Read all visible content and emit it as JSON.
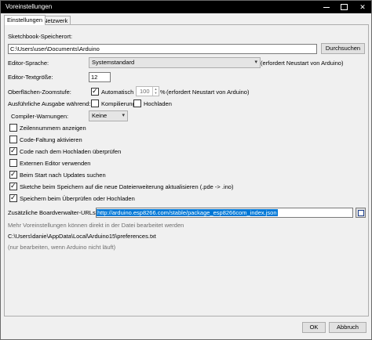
{
  "window": {
    "title": "Voreinstellungen"
  },
  "tabs": [
    {
      "label": "Einstellungen",
      "active": true
    },
    {
      "label": "Netzwerk",
      "active": false
    }
  ],
  "sketchbook": {
    "label": "Sketchbook-Speicherort:",
    "path": "C:\\Users\\user\\Documents\\Arduino",
    "browse_label": "Durchsuchen"
  },
  "editor_language": {
    "label": "Editor-Sprache:",
    "value": "Systemstandard",
    "note": "(erfordert Neustart von Arduino)"
  },
  "editor_font_size": {
    "label": "Editor-Textgröße:",
    "value": "12"
  },
  "ui_zoom": {
    "label": "Oberflächen-Zoomstufe:",
    "auto_label": "Automatisch",
    "auto_checked": true,
    "value": "100",
    "unit": "%",
    "note": "(erfordert Neustart von Arduino)"
  },
  "verbose_output": {
    "label": "Ausführliche Ausgabe während:",
    "compile_label": "Kompilierung",
    "compile_checked": false,
    "upload_label": "Hochladen",
    "upload_checked": false
  },
  "compiler_warnings": {
    "label": "Compiler-Warnungen:",
    "value": "Keine"
  },
  "options": [
    {
      "label": "Zeilennummern anzeigen",
      "checked": false
    },
    {
      "label": "Code-Faltung aktivieren",
      "checked": false
    },
    {
      "label": "Code nach dem Hochladen überprüfen",
      "checked": true
    },
    {
      "label": "Externen Editor verwenden",
      "checked": false
    },
    {
      "label": "Beim Start nach Updates suchen",
      "checked": true
    },
    {
      "label": "Sketche beim Speichern auf die neue Dateierweiterung aktualisieren (.pde -> .ino)",
      "checked": true
    },
    {
      "label": "Speichern beim Überprüfen oder Hochladen",
      "checked": true
    }
  ],
  "board_manager": {
    "label": "Zusätzliche Boardverwalter-URLs:",
    "url": "http://arduino.esp8266.com/stable/package_esp8266com_index.json"
  },
  "more_prefs": {
    "hint": "Mehr Voreinstellungen können direkt in der Datei bearbeitet werden",
    "path": "C:\\Users\\danie\\AppData\\Local\\Arduino15\\preferences.txt",
    "edit_note": "(nur bearbeiten, wenn Arduino nicht läuft)"
  },
  "footer": {
    "ok_label": "OK",
    "cancel_label": "Abbruch"
  }
}
